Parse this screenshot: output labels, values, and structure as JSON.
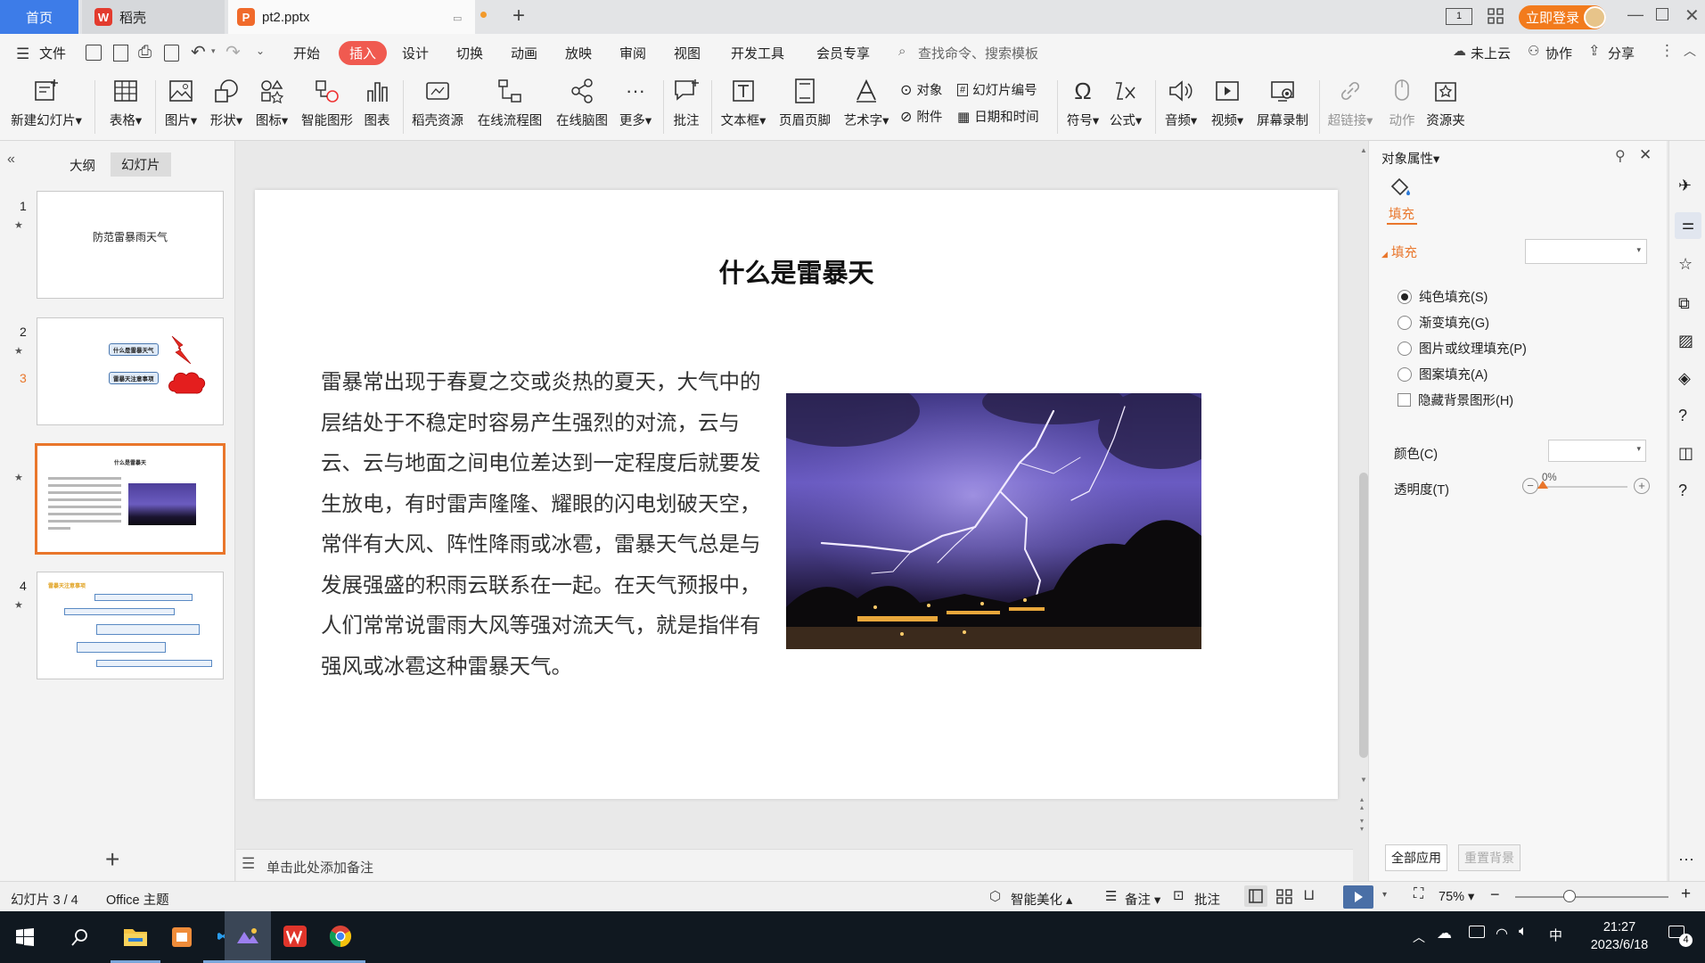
{
  "tabs": {
    "home": "首页",
    "daoke": "稻壳",
    "doc": "pt2.pptx"
  },
  "account": {
    "login": "立即登录"
  },
  "menu": {
    "file": "文件",
    "items": [
      "开始",
      "插入",
      "设计",
      "切换",
      "动画",
      "放映",
      "审阅",
      "视图",
      "开发工具",
      "会员专享"
    ],
    "search_placeholder": "查找命令、搜索模板",
    "cloud": "未上云",
    "collab": "协作",
    "share": "分享"
  },
  "ribbon": {
    "new_slide": "新建幻灯片",
    "table": "表格",
    "picture": "图片",
    "shape": "形状",
    "icon": "图标",
    "smart_graphic": "智能图形",
    "chart": "图表",
    "daoke_res": "稻壳资源",
    "flowchart": "在线流程图",
    "mindmap": "在线脑图",
    "more": "更多",
    "comment": "批注",
    "textbox": "文本框",
    "header_footer": "页眉页脚",
    "wordart": "艺术字",
    "object": "对象",
    "slide_number": "幻灯片编号",
    "attachment": "附件",
    "datetime": "日期和时间",
    "symbol": "符号",
    "formula": "公式",
    "audio": "音频",
    "video": "视频",
    "screen_record": "屏幕录制",
    "hyperlink": "超链接",
    "action": "动作",
    "resource": "资源夹"
  },
  "left_panel": {
    "tab_outline": "大纲",
    "tab_slides": "幻灯片",
    "thumbs": [
      {
        "num": "1",
        "title": "防范雷暴雨天气"
      },
      {
        "num": "2",
        "labels": [
          "什么是雷暴天气",
          "雷暴天注意事项"
        ]
      },
      {
        "num": "3",
        "title": "什么是雷暴天"
      },
      {
        "num": "4",
        "title": "雷暴天注意事项"
      }
    ],
    "add": "+"
  },
  "slide": {
    "title": "什么是雷暴天",
    "body": "雷暴常出现于春夏之交或炎热的夏天，大气中的层结处于不稳定时容易产生强烈的对流，云与云、云与地面之间电位差达到一定程度后就要发生放电，有时雷声隆隆、耀眼的闪电划破天空，常伴有大风、阵性降雨或冰雹，雷暴天气总是与发展强盛的积雨云联系在一起。在天气预报中，人们常常说雷雨大风等强对流天气，就是指伴有强风或冰雹这种雷暴天气。"
  },
  "notes": {
    "placeholder": "单击此处添加备注"
  },
  "pane": {
    "header": "对象属性",
    "tab_fill": "填充",
    "section_fill": "填充",
    "options": [
      "纯色填充(S)",
      "渐变填充(G)",
      "图片或纹理填充(P)",
      "图案填充(A)"
    ],
    "hide_bg": "隐藏背景图形(H)",
    "color_label": "颜色(C)",
    "transparency_label": "透明度(T)",
    "transparency_value": "0%",
    "apply_all": "全部应用",
    "reset_bg": "重置背景"
  },
  "status": {
    "slide_pos": "幻灯片 3 / 4",
    "theme": "Office 主题",
    "beautify": "智能美化",
    "notes": "备注",
    "comments": "批注",
    "zoom": "75%"
  },
  "taskbar": {
    "time": "21:27",
    "date": "2023/6/18",
    "ime": "中",
    "notif_count": "4"
  },
  "colors": {
    "accent": "#f05a50",
    "home_tab": "#3d7ce8",
    "login": "#f27b1d",
    "selected_thumb": "#e9762b"
  }
}
